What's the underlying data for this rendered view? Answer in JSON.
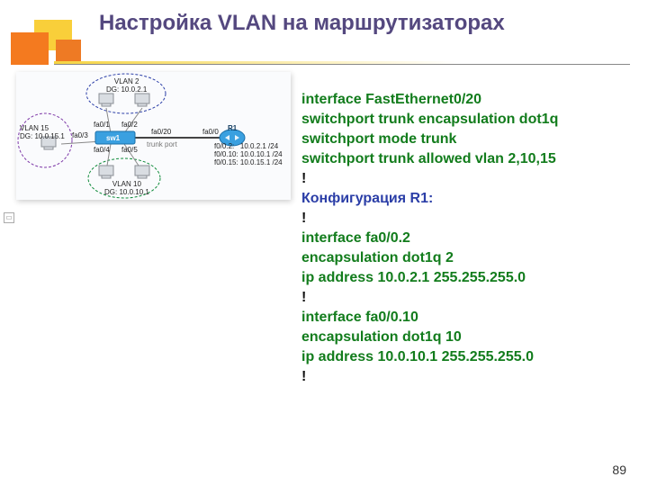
{
  "title": "Настройка VLAN на маршрутизаторах",
  "page_number": "89",
  "diagram": {
    "vlan2": "VLAN 2\nDG: 10.0.2.1",
    "vlan15": "VLAN 15\nDG: 10.0.15.1",
    "vlan10": "VLAN 10\nDG: 10.0.10.1",
    "fa01": "fa0/1",
    "fa02": "fa0/2",
    "fa03": "fa0/3",
    "fa04": "fa0/4",
    "fa05": "fa0/5",
    "fa020": "fa0/20",
    "fa00": "fa0/0",
    "sw1": "sw1",
    "r1": "R1",
    "trunk": "trunk port",
    "subs": "f0/0.2:   10.0.2.1 /24\nf0/0.10: 10.0.10.1 /24\nf0/0.15: 10.0.15.1 /24"
  },
  "code": {
    "l1": "interface FastEthernet0/20",
    "l2": " switchport trunk encapsulation dot1q",
    "l3": " switchport mode trunk",
    "l4": " switchport trunk allowed vlan 2,10,15",
    "l5": "!",
    "l6": "Конфигурация R1:",
    "l7": "!",
    "l8": "interface fa0/0.2",
    "l9": " encapsulation dot1q 2",
    "l10": " ip address 10.0.2.1 255.255.255.0",
    "l11": "!",
    "l12": "interface fa0/0.10",
    "l13": " encapsulation dot1q 10",
    "l14": " ip address 10.0.10.1 255.255.255.0",
    "l15": "!"
  }
}
